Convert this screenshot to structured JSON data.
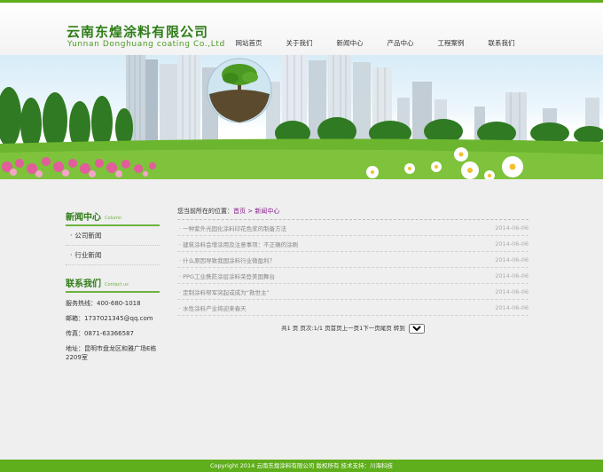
{
  "header": {
    "logo_cn": "云南东煌涂料有限公司",
    "logo_en": "Yunnan Donghuang coating Co.,Ltd",
    "nav": [
      "网站首页",
      "关于我们",
      "新闻中心",
      "产品中心",
      "工程案例",
      "联系我们"
    ]
  },
  "sidebar": {
    "news_title": "新闻中心",
    "news_title_en": "Column",
    "items": [
      "公司新闻",
      "行业新闻"
    ],
    "contact_title": "联系我们",
    "contact_title_en": "Contact us",
    "contact": {
      "phone": "服务热线：400-680-1018",
      "email": "邮箱：1737021345@qq.com",
      "fax": "传真：0871-63366587",
      "address": "地址：昆明市盘龙区和雅广场E栋2209室"
    }
  },
  "main": {
    "crumb_prefix": "您当前所在的位置：",
    "crumb_home": "首页",
    "crumb_sep": " > ",
    "crumb_current": "新闻中心",
    "news": [
      {
        "title": "一种紫外光固化涂料印花色浆的制备方法",
        "date": "2014-06-06"
      },
      {
        "title": "建筑涂料会增涂用及注意事项：不正确的涂刷",
        "date": "2014-06-06"
      },
      {
        "title": "什么原因导致我国涂料行业微盈利？",
        "date": "2014-06-06"
      },
      {
        "title": "PPG工业携防涂层涂料荣登美国舞台",
        "date": "2014-06-06"
      },
      {
        "title": "定制涂料帮军突起或成为“救世主”",
        "date": "2014-06-06"
      },
      {
        "title": "水性涂料产业将迎来春天",
        "date": "2014-06-06"
      }
    ],
    "pager_text": "共1 页 页次:1/1 页首页上一页1下一页尾页 转到",
    "pager_select": "1"
  },
  "footer": {
    "text": "Copyright 2014 云南东煌涂料有限公司 版权所有    技术支持：川海科技"
  },
  "colors": {
    "brand_green": "#5fae1b",
    "title_green": "#2f7d19",
    "crumb_purple": "#8a1c8e"
  }
}
